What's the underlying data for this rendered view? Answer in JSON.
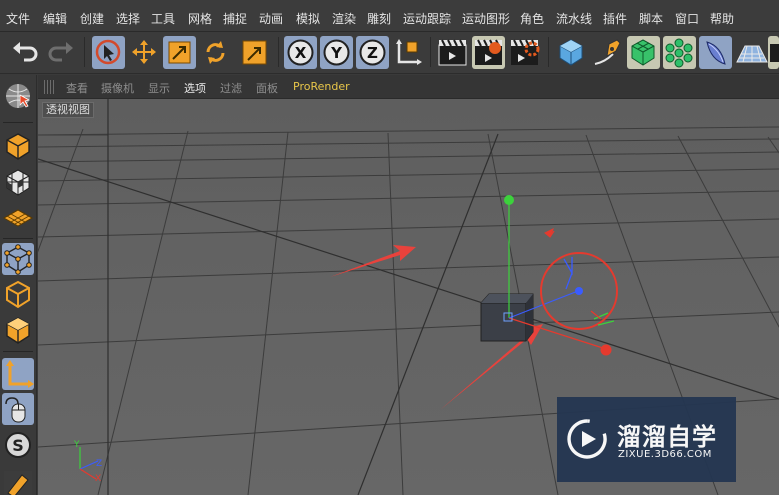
{
  "menu": {
    "items": [
      {
        "key": "file",
        "label": "文件"
      },
      {
        "key": "edit",
        "label": "编辑"
      },
      {
        "key": "create",
        "label": "创建"
      },
      {
        "key": "select",
        "label": "选择"
      },
      {
        "key": "tools",
        "label": "工具"
      },
      {
        "key": "mesh",
        "label": "网格"
      },
      {
        "key": "snap",
        "label": "捕捉"
      },
      {
        "key": "animate",
        "label": "动画"
      },
      {
        "key": "simulate",
        "label": "模拟"
      },
      {
        "key": "render",
        "label": "渲染"
      },
      {
        "key": "sculpt",
        "label": "雕刻"
      },
      {
        "key": "motion-tracking",
        "label": "运动跟踪"
      },
      {
        "key": "mograph",
        "label": "运动图形"
      },
      {
        "key": "character",
        "label": "角色"
      },
      {
        "key": "pipeline",
        "label": "流水线"
      },
      {
        "key": "plugins",
        "label": "插件"
      },
      {
        "key": "script",
        "label": "脚本"
      },
      {
        "key": "window",
        "label": "窗口"
      },
      {
        "key": "help",
        "label": "帮助"
      }
    ]
  },
  "toolbar": {
    "undo": "undo-icon",
    "redo": "redo-icon",
    "tools": [
      "live-selection-icon",
      "move-icon",
      "scale-icon",
      "rotate-icon",
      "recent-tool-icon"
    ],
    "axis_lock": {
      "x": "X",
      "y": "Y",
      "z": "Z"
    },
    "coordinate_system": "world-coordinates-icon",
    "render": [
      "render-view-icon",
      "render-to-picture-viewer-icon",
      "render-settings-icon"
    ],
    "objects": [
      "cube-icon",
      "pen-spline-icon",
      "subdivision-surface-icon",
      "cloner-icon",
      "deformer-icon",
      "floor-icon",
      "camera-icon"
    ]
  },
  "left_palette": {
    "items": [
      "view-switch-icon",
      "make-editable-icon",
      "texture-mode-icon",
      "workplane-icon",
      "points-mode-icon",
      "edges-mode-icon",
      "polygons-mode-icon",
      "enable-axis-icon",
      "tweak-mode-icon",
      "snap-icon",
      "sculpt-brush-icon"
    ]
  },
  "view_menu": {
    "items": [
      {
        "key": "view",
        "label": "查看"
      },
      {
        "key": "cameras",
        "label": "摄像机"
      },
      {
        "key": "display",
        "label": "显示"
      },
      {
        "key": "options",
        "label": "选项"
      },
      {
        "key": "filter",
        "label": "过滤"
      },
      {
        "key": "panel",
        "label": "面板"
      },
      {
        "key": "prorender",
        "label": "ProRender"
      }
    ]
  },
  "viewport": {
    "label": "透视视图",
    "axes": {
      "y": "Y",
      "z": "Z",
      "x": "X"
    },
    "colors": {
      "x_axis": "#e53a2e",
      "y_axis": "#3cd23c",
      "z_axis": "#3a5cff",
      "annotation_arrow": "#e8423c"
    }
  },
  "watermark": {
    "title": "溜溜自学",
    "url": "ZIXUE.3D66.COM",
    "background": "#243651"
  }
}
